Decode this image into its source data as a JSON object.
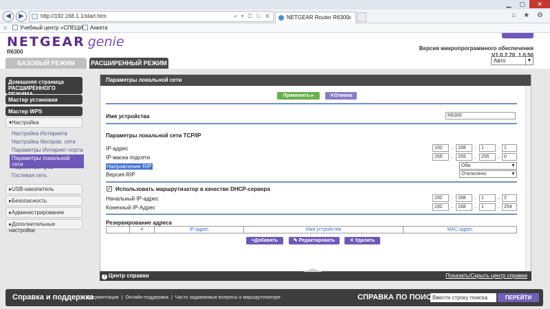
{
  "browser": {
    "url": "http://192.168.1.1/start.htm",
    "tab_title": "NETGEAR Router R6300",
    "tab_close": "✕",
    "back_icon": "◀",
    "forward_icon": "▶",
    "addr_tools": "⌕ ▾ ◫ ↻ ✕",
    "right_icons": "⌂ ★ ⚙",
    "favorites": [
      {
        "label": "Учебный центр «СПЕЦИ..."
      },
      {
        "label": "Анкета"
      }
    ],
    "window_controls": {
      "min": "▁",
      "max": "▢",
      "close": "✕"
    }
  },
  "header": {
    "brand": "NETGEAR",
    "genie": "genie",
    "model": "R6300",
    "firmware_label": "Версия микропрограммного обеспечения",
    "firmware_version": "V1.0.2.70_1.0.50",
    "basic_tab": "БАЗОВЫЙ РЕЖИМ",
    "advanced_tab": "РАСШИРЕННЫЙ РЕЖИМ",
    "language": "Авто",
    "dropdown_arrow": "▼"
  },
  "sidebar": {
    "home": "Домашняя страница РАСШИРЕННОГО РЕЖИМА",
    "setup_wizard": "Мастер установки",
    "wps_wizard": "Мастер WPS",
    "setup": "▾Настройка",
    "setup_items": [
      {
        "label": "Настройка Интернета"
      },
      {
        "label": "Настройка беспров. сети"
      },
      {
        "label": "Параметры Интернет-порта"
      },
      {
        "label": "Параметры локальной сети"
      },
      {
        "label": "Параметры QoS"
      },
      {
        "label": "Гостевая сеть"
      }
    ],
    "usb": "▸USB-накопитель",
    "security": "▸Безопасность",
    "admin": "▸Администрирование",
    "advanced": "▸Дополнительные настройки"
  },
  "panel": {
    "title": "Параметры локальной сети",
    "apply": "Применить ▸",
    "cancel": "✕Отмена",
    "device_name_label": "Имя устройства",
    "device_name": "R6300",
    "tcpip_title": "Параметры локальной сети TCP/IP",
    "ip_label": "IP-адрес",
    "ip": [
      "192",
      "168",
      "1",
      "1"
    ],
    "mask_label": "IP-маска подсети",
    "mask": [
      "255",
      "255",
      "255",
      "0"
    ],
    "rip_dir_label": "Направление RIP",
    "rip_dir": "Оба",
    "rip_ver_label": "Версия RIP",
    "rip_ver": "Отключено",
    "dhcp_check": "✓",
    "dhcp_label": "Использовать маршрутизатор в качестве DHCP-сервера",
    "start_ip_label": "Начальный IP-адрес",
    "start_ip": [
      "192",
      "168",
      "1",
      "2"
    ],
    "end_ip_label": "Конечный IP-Адрес",
    "end_ip": [
      "192",
      "168",
      "1",
      "254"
    ],
    "reservation_title": "Резервирование адреса",
    "table_headers": [
      "",
      "#",
      "IP-адрес",
      "Имя устройства",
      "MAC-адрес"
    ],
    "add": "+Добавить",
    "edit": "✎ Редактировать",
    "delete": "✕ Удалить"
  },
  "helpbar": {
    "help_icon": "?",
    "help_center": "Центр справки",
    "toggle": "Показать/Скрыть центр справки"
  },
  "footer": {
    "support_title": "Справка и поддержка",
    "links": [
      "Документация",
      "Онлайн-поддержка",
      "Часто задаваемые вопросы о маршрутизаторе"
    ],
    "separator": "|",
    "search_title": "СПРАВКА ПО ПОИСКУ",
    "search_placeholder": "Ввести строку поиска",
    "go": "ПЕРЕЙТИ"
  }
}
